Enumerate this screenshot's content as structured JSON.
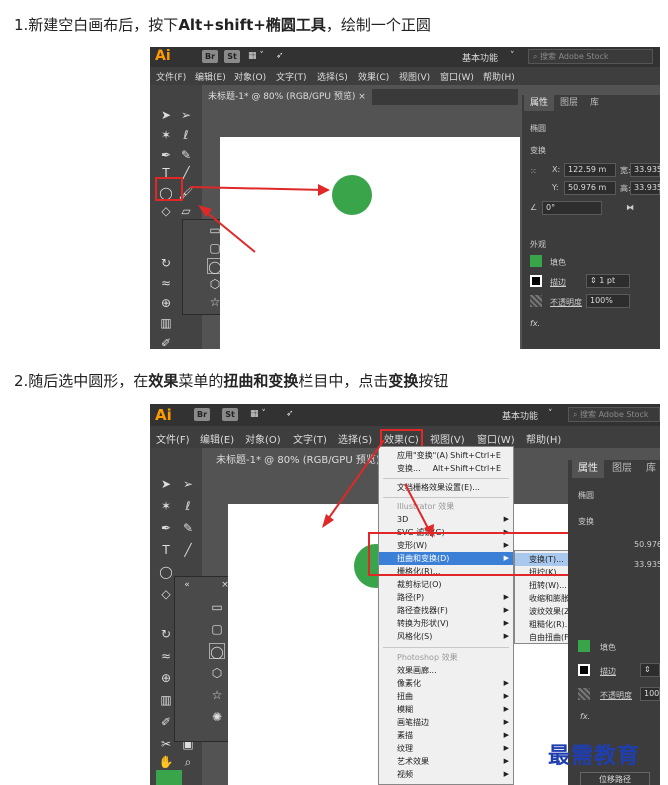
{
  "step1": {
    "prefix": "1.新建空白画布后，按下",
    "keys": "Alt+shift+椭圆工具",
    "suffix": "，绘制一个正圆"
  },
  "step2": {
    "prefix": "2.随后选中圆形，在",
    "menu": "效果",
    "mid1": "菜单的",
    "group": "扭曲和变换",
    "mid2": "栏目中，点击",
    "item": "变换",
    "suffix": "按钮"
  },
  "app": {
    "logo": "Ai",
    "br": "Br",
    "st": "St",
    "workspace": "基本功能",
    "search_placeholder": "搜索 Adobe Stock",
    "doc_tab1": "未标题-1* @ 80% (RGB/GPU 预览)",
    "doc_tab2": "未标题-1* @ 80% (RGB/GPU 预览)",
    "menus": [
      "文件(F)",
      "编辑(E)",
      "对象(O)",
      "文字(T)",
      "选择(S)",
      "效果(C)",
      "视图(V)",
      "窗口(W)",
      "帮助(H)"
    ]
  },
  "panel": {
    "tabs": [
      "属性",
      "图层",
      "库"
    ],
    "section_shape": "椭圆",
    "section_transform": "变换",
    "x_label": "X:",
    "x_value": "122.59 m",
    "y_label": "Y:",
    "y_value": "50.976 m",
    "w_label": "宽:",
    "w_value": "33.935",
    "h_label": "高:",
    "h_value": "33.935",
    "angle_value": "0°",
    "section_appearance": "外观",
    "fill_label": "填色",
    "stroke_label": "描边",
    "stroke_value": "1 pt",
    "opacity_label": "不透明度",
    "opacity_value": "100%",
    "fx_label": "fx.",
    "opacity_value_short": "100",
    "bottom_button": "位移路径"
  },
  "colors": {
    "fill": "#3aa44a",
    "highlight": "#e02828",
    "menu_hl": "#3b7fd6"
  },
  "effect_menu": {
    "items": [
      {
        "label": "应用\"变换\"(A)",
        "shortcut": "Shift+Ctrl+E"
      },
      {
        "label": "变换...",
        "shortcut": "Alt+Shift+Ctrl+E"
      },
      {
        "label": "文档栅格效果设置(E)...",
        "shortcut": ""
      },
      {
        "label": "Illustrator 效果",
        "shortcut": ""
      },
      {
        "label": "3D",
        "shortcut": ""
      },
      {
        "label": "SVG 滤镜(G)",
        "shortcut": ""
      },
      {
        "label": "变形(W)",
        "shortcut": ""
      },
      {
        "label": "扭曲和变换(D)",
        "shortcut": ""
      },
      {
        "label": "栅格化(R)...",
        "shortcut": ""
      },
      {
        "label": "裁剪标记(O)",
        "shortcut": ""
      },
      {
        "label": "路径(P)",
        "shortcut": ""
      },
      {
        "label": "路径查找器(F)",
        "shortcut": ""
      },
      {
        "label": "转换为形状(V)",
        "shortcut": ""
      },
      {
        "label": "风格化(S)",
        "shortcut": ""
      },
      {
        "label": "Photoshop 效果",
        "shortcut": ""
      },
      {
        "label": "效果画廊...",
        "shortcut": ""
      },
      {
        "label": "像素化",
        "shortcut": ""
      },
      {
        "label": "扭曲",
        "shortcut": ""
      },
      {
        "label": "模糊",
        "shortcut": ""
      },
      {
        "label": "画笔描边",
        "shortcut": ""
      },
      {
        "label": "素描",
        "shortcut": ""
      },
      {
        "label": "纹理",
        "shortcut": ""
      },
      {
        "label": "艺术效果",
        "shortcut": ""
      },
      {
        "label": "视频",
        "shortcut": ""
      }
    ],
    "submenu": [
      "变换(T)...",
      "扭拧(K)...",
      "扭转(W)...",
      "收缩和膨胀(P)...",
      "波纹效果(Z)...",
      "粗糙化(R)...",
      "自由扭曲(F)..."
    ]
  },
  "watermark": "最需教育"
}
